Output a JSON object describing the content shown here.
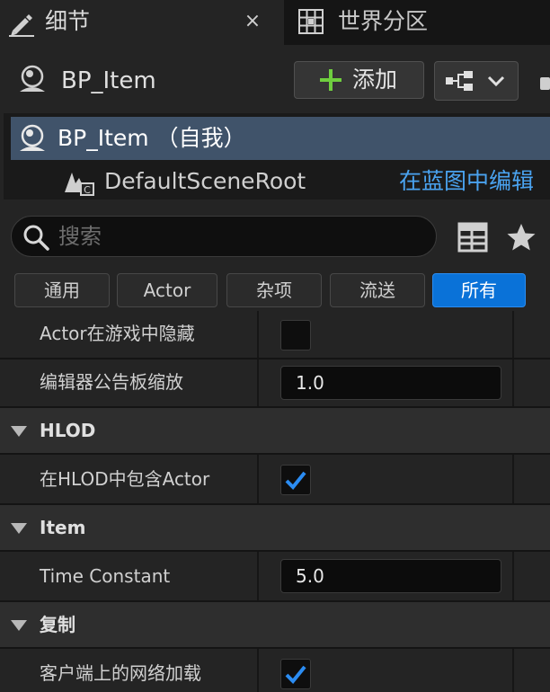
{
  "tabs": {
    "details_label": "细节",
    "close_glyph": "×",
    "world_partition_label": "世界分区"
  },
  "header": {
    "title": "BP_Item",
    "add_label": "添加"
  },
  "component_tree": {
    "root_label": "BP_Item （自我）",
    "child_label": "DefaultSceneRoot",
    "edit_in_blueprint": "在蓝图中编辑"
  },
  "search": {
    "placeholder": "搜索",
    "value": ""
  },
  "filters": [
    {
      "label": "通用",
      "active": false
    },
    {
      "label": "Actor",
      "active": false
    },
    {
      "label": "杂项",
      "active": false
    },
    {
      "label": "流送",
      "active": false
    },
    {
      "label": "所有",
      "active": true
    }
  ],
  "properties": {
    "actor_hidden_in_game": {
      "label": "Actor在游戏中隐藏",
      "checked": false
    },
    "editor_billboard_scale": {
      "label": "编辑器公告板缩放",
      "value": "1.0"
    },
    "hlod_section": "HLOD",
    "include_actor_in_hlod": {
      "label": "在HLOD中包含Actor",
      "checked": true
    },
    "item_section": "Item",
    "time_constant": {
      "label": "Time Constant",
      "value": "5.0"
    },
    "replication_section": "复制",
    "net_load_on_client": {
      "label": "客户端上的网络加载",
      "checked": true
    }
  },
  "colors": {
    "accent_blue": "#0a72d8",
    "link_blue": "#4aa3f0",
    "selection_row": "#40536a",
    "panel_bg": "#242424",
    "add_plus_green": "#6fce3f",
    "checkmark_blue": "#2b8cf2"
  },
  "icons": {
    "details_tab": "pencil-icon",
    "world_partition_tab": "grid-icon",
    "blueprint": "actor-sphere-icon",
    "add": "plus-icon",
    "blueprint_menu": "node-graph-icon",
    "scene_root": "scene-component-icon",
    "search": "search-icon",
    "table_view": "table-icon",
    "favorites": "star-icon"
  }
}
